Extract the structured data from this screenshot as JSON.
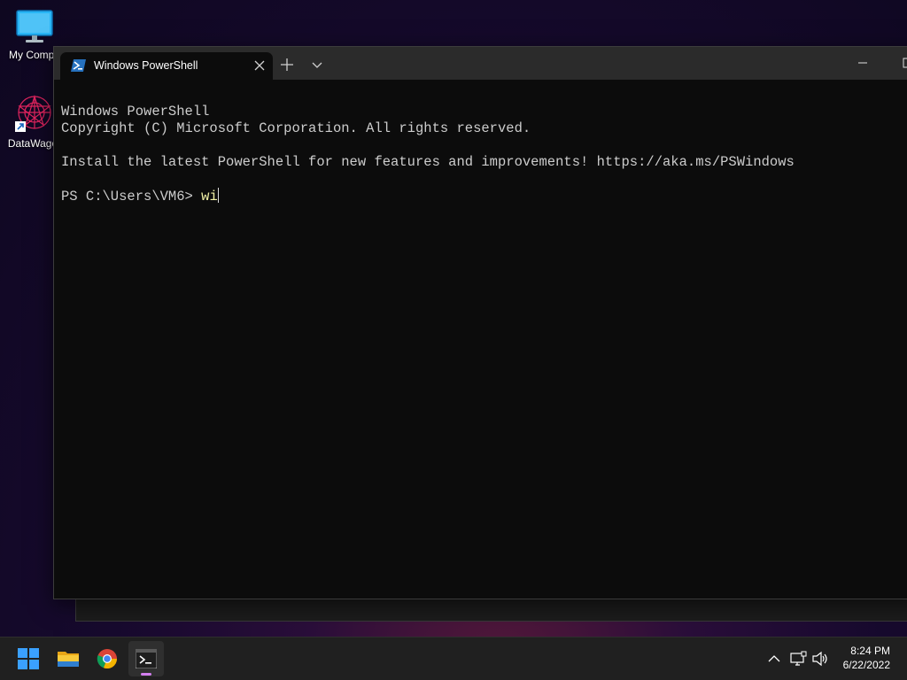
{
  "desktop": {
    "icons": [
      {
        "label": "My Compu"
      },
      {
        "label": "DataWagor"
      }
    ]
  },
  "window": {
    "tab_title": "Windows PowerShell",
    "console_lines": [
      "Windows PowerShell",
      "Copyright (C) Microsoft Corporation. All rights reserved.",
      "",
      "Install the latest PowerShell for new features and improvements! https://aka.ms/PSWindows",
      ""
    ],
    "prompt": "PS C:\\Users\\VM6> ",
    "typed_input": "wi"
  },
  "taskbar": {
    "apps": [
      "start-icon",
      "file-explorer-icon",
      "chrome-icon",
      "terminal-icon"
    ],
    "time": "8:24 PM",
    "date": "6/22/2022"
  },
  "colors": {
    "accent_indicator": "#d37ff0",
    "console_text": "#cccccc",
    "typed_text": "#f1f1a6"
  }
}
